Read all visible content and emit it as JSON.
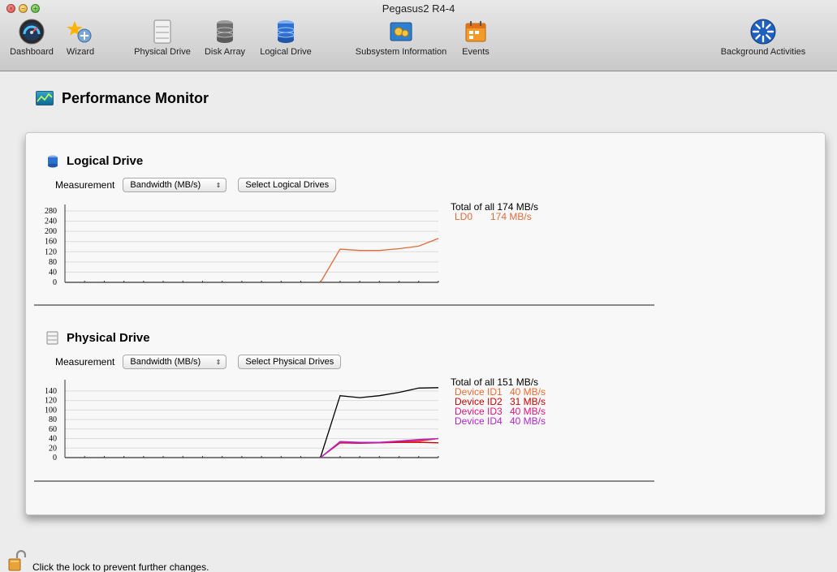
{
  "window": {
    "title": "Pegasus2 R4-4",
    "traffic": [
      "×",
      "−",
      "+"
    ]
  },
  "toolbar": {
    "items": [
      {
        "label": "Dashboard",
        "icon": "dashboard-gauge-icon"
      },
      {
        "label": "Wizard",
        "icon": "wizard-icon"
      },
      {
        "label": "Physical Drive",
        "icon": "physical-drive-icon"
      },
      {
        "label": "Disk Array",
        "icon": "disk-array-icon"
      },
      {
        "label": "Logical Drive",
        "icon": "logical-drive-icon"
      },
      {
        "label": "Subsystem Information",
        "icon": "subsystem-info-icon"
      },
      {
        "label": "Events",
        "icon": "events-calendar-icon"
      },
      {
        "label": "Background Activities",
        "icon": "background-activities-icon"
      }
    ]
  },
  "page": {
    "title": "Performance Monitor"
  },
  "logical": {
    "title": "Logical Drive",
    "measurement_label": "Measurement",
    "select_value": "Bandwidth (MB/s)",
    "select_arrows": "⇕",
    "button_label": "Select Logical Drives"
  },
  "physical": {
    "title": "Physical Drive",
    "measurement_label": "Measurement",
    "select_value": "Bandwidth (MB/s)",
    "select_arrows": "⇕",
    "button_label": "Select Physical Drives"
  },
  "chart_data": [
    {
      "type": "line",
      "yticks": [
        0,
        40,
        80,
        120,
        160,
        200,
        240,
        280
      ],
      "ylim": [
        0,
        280
      ],
      "x": [
        0,
        1,
        2,
        3,
        4,
        5,
        6,
        7,
        8,
        9,
        10,
        11,
        12,
        13,
        14,
        15,
        16,
        17,
        18,
        19
      ],
      "series": [
        {
          "name": "LD0",
          "color": "#e06a3a",
          "values": [
            null,
            null,
            null,
            null,
            null,
            null,
            null,
            null,
            null,
            null,
            null,
            null,
            null,
            0,
            130,
            125,
            125,
            132,
            142,
            172
          ]
        }
      ],
      "legend_header": "Total of all 174 MB/s",
      "legend": [
        {
          "name": "LD0",
          "value": "174 MB/s",
          "color": "#e06a3a"
        }
      ],
      "grid": true
    },
    {
      "type": "line",
      "yticks": [
        0,
        20,
        40,
        60,
        80,
        100,
        120,
        140
      ],
      "ylim": [
        0,
        150
      ],
      "x": [
        0,
        1,
        2,
        3,
        4,
        5,
        6,
        7,
        8,
        9,
        10,
        11,
        12,
        13,
        14,
        15,
        16,
        17,
        18,
        19
      ],
      "series": [
        {
          "name": "Total",
          "color": "#000000",
          "values": [
            null,
            null,
            null,
            null,
            null,
            null,
            null,
            null,
            null,
            null,
            null,
            null,
            null,
            0,
            130,
            126,
            130,
            137,
            146,
            147
          ]
        },
        {
          "name": "Device ID1",
          "color": "#f06a30",
          "values": [
            null,
            null,
            null,
            null,
            null,
            null,
            null,
            null,
            null,
            null,
            null,
            null,
            null,
            0,
            33,
            31,
            32,
            33,
            34,
            40
          ]
        },
        {
          "name": "Device ID2",
          "color": "#cc0000",
          "values": [
            null,
            null,
            null,
            null,
            null,
            null,
            null,
            null,
            null,
            null,
            null,
            null,
            null,
            0,
            31,
            30,
            31,
            32,
            32,
            31
          ]
        },
        {
          "name": "Device ID3",
          "color": "#e0157a",
          "values": [
            null,
            null,
            null,
            null,
            null,
            null,
            null,
            null,
            null,
            null,
            null,
            null,
            null,
            0,
            32,
            31,
            31,
            34,
            36,
            40
          ]
        },
        {
          "name": "Device ID4",
          "color": "#b026c9",
          "values": [
            null,
            null,
            null,
            null,
            null,
            null,
            null,
            null,
            null,
            null,
            null,
            null,
            null,
            0,
            34,
            32,
            32,
            35,
            38,
            40
          ]
        }
      ],
      "legend_header": "Total of all 151 MB/s",
      "legend": [
        {
          "name": "Device ID1",
          "value": "40 MB/s",
          "color": "#f06a30"
        },
        {
          "name": "Device ID2",
          "value": "31 MB/s",
          "color": "#cc0000"
        },
        {
          "name": "Device ID3",
          "value": "40 MB/s",
          "color": "#e0157a"
        },
        {
          "name": "Device ID4",
          "value": "40 MB/s",
          "color": "#b026c9"
        }
      ],
      "grid": true
    }
  ],
  "footer": {
    "text": "Click the lock to prevent further changes."
  }
}
